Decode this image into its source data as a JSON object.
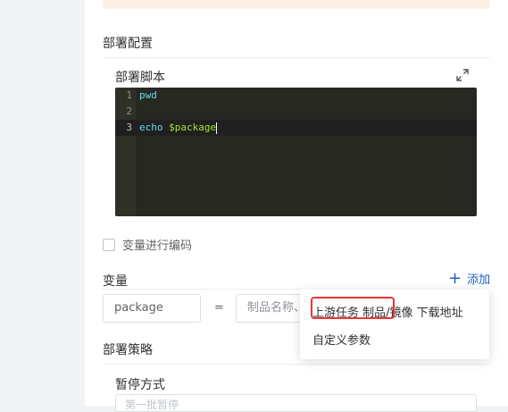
{
  "deploy": {
    "section_title": "部署配置",
    "script_label": "部署脚本",
    "expand_icon": "expand-icon",
    "script_lines": [
      {
        "num": "1",
        "keyword": "pwd",
        "rest": ""
      },
      {
        "num": "2",
        "keyword": "",
        "rest": ""
      },
      {
        "num": "3",
        "keyword": "echo ",
        "rest": "$package"
      }
    ],
    "encode_checkbox_label": "变量进行编码",
    "encode_checked": false
  },
  "variables": {
    "title": "变量",
    "add_label": "添加",
    "name_value": "package",
    "equals": "=",
    "value_placeholder": "制品名称、"
  },
  "dropdown": {
    "item1_part1": "上游任务 制品",
    "item1_part2": "/镜像 下载地址",
    "item2": "自定义参数"
  },
  "strategy": {
    "title": "部署策略",
    "pause_label": "暂停方式",
    "pause_value": "第一批暂停"
  },
  "colors": {
    "accent": "#1f5fbf",
    "highlight": "#e53935",
    "editor_bg": "#272822",
    "banner": "#fdf1e6"
  }
}
